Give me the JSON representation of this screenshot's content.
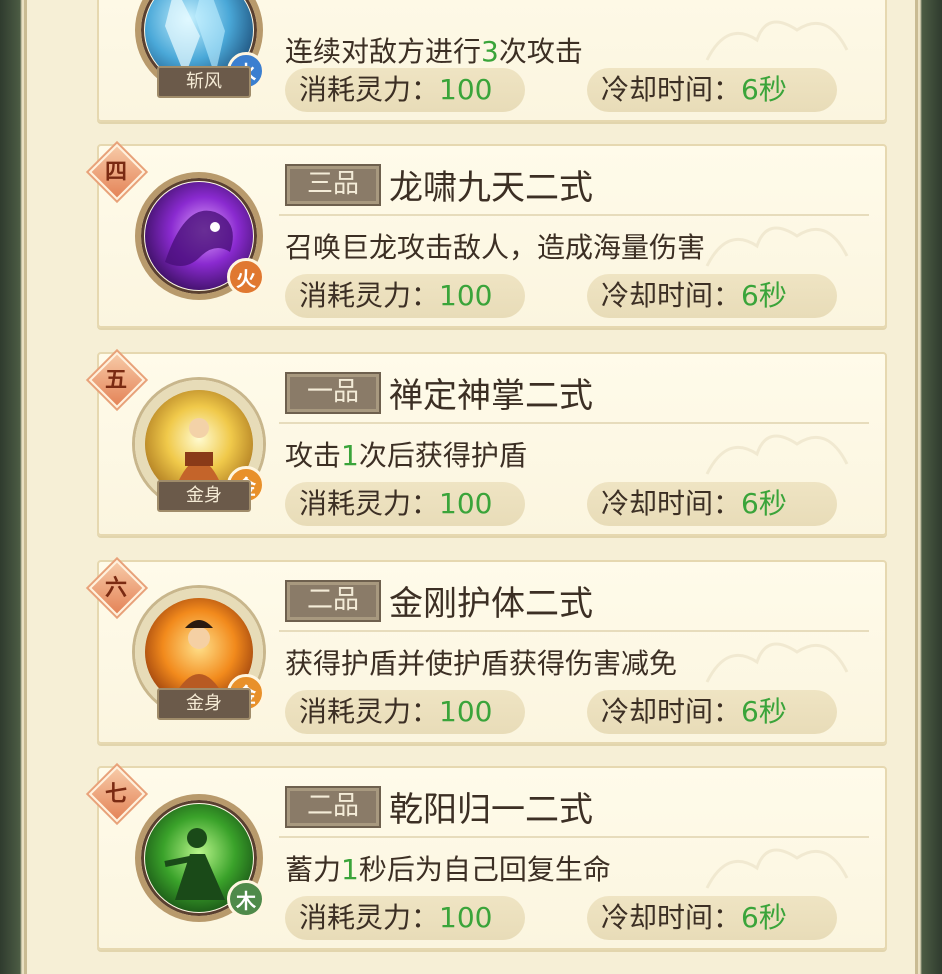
{
  "skills": [
    {
      "rank": "",
      "grade": "",
      "name": "",
      "desc_parts": [
        "连续对敌方进行",
        "3",
        "次攻击"
      ],
      "element": "水",
      "element_color": "#3b7fd0",
      "tag": "斩风",
      "cost_label": "消耗灵力：",
      "cost_value": "100",
      "cd_label": "冷却时间：",
      "cd_value": "6秒",
      "art_icon": "ice-blade-icon"
    },
    {
      "rank": "四",
      "grade": "三品",
      "name": "龙啸九天二式",
      "desc_parts": [
        "召唤巨龙攻击敌人，造成海量伤害",
        "",
        ""
      ],
      "element": "火",
      "element_color": "#e07830",
      "tag": "",
      "cost_label": "消耗灵力：",
      "cost_value": "100",
      "cd_label": "冷却时间：",
      "cd_value": "6秒",
      "art_icon": "purple-dragon-icon"
    },
    {
      "rank": "五",
      "grade": "一品",
      "name": "禅定神掌二式",
      "desc_parts": [
        "攻击",
        "1",
        "次后获得护盾"
      ],
      "element": "金",
      "element_color": "#e8902a",
      "tag": "金身",
      "cost_label": "消耗灵力：",
      "cost_value": "100",
      "cd_label": "冷却时间：",
      "cd_value": "6秒",
      "art_icon": "meditating-monk-icon"
    },
    {
      "rank": "六",
      "grade": "二品",
      "name": "金刚护体二式",
      "desc_parts": [
        "获得护盾并使护盾获得伤害减免",
        "",
        ""
      ],
      "element": "金",
      "element_color": "#e8902a",
      "tag": "金身",
      "cost_label": "消耗灵力：",
      "cost_value": "100",
      "cd_label": "冷却时间：",
      "cd_value": "6秒",
      "art_icon": "flame-monk-icon"
    },
    {
      "rank": "七",
      "grade": "二品",
      "name": "乾阳归一二式",
      "desc_parts": [
        "蓄力",
        "1",
        "秒后为自己回复生命"
      ],
      "element": "木",
      "element_color": "#4f8a4a",
      "tag": "",
      "cost_label": "消耗灵力：",
      "cost_value": "100",
      "cd_label": "冷却时间：",
      "cd_value": "6秒",
      "art_icon": "green-spirit-icon"
    }
  ]
}
